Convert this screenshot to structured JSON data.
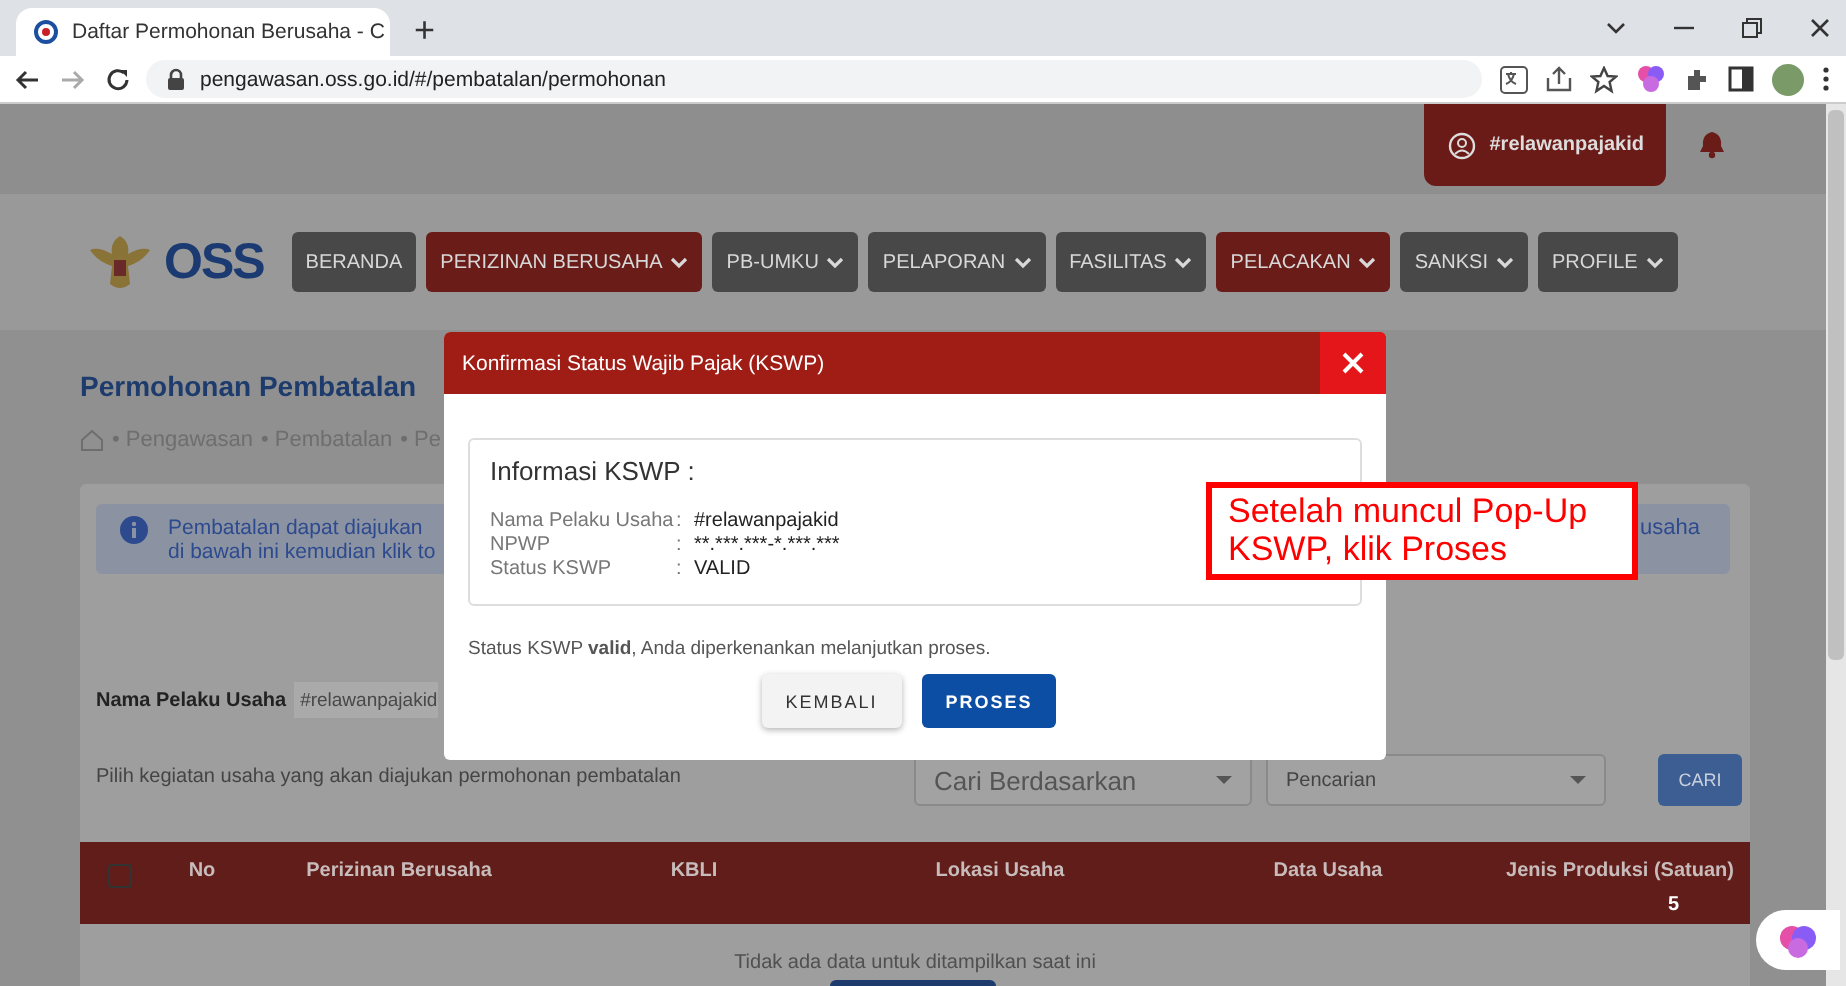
{
  "browser": {
    "tab_title": "Daftar Permohonan Berusaha - C",
    "new_tab": "+",
    "url": "pengawasan.oss.go.id/#/pembatalan/permohonan"
  },
  "header": {
    "user": "#relawanpajakid",
    "logo": "OSS",
    "nav": [
      {
        "label": "BERANDA",
        "has_menu": false,
        "highlighted": false
      },
      {
        "label": "PERIZINAN BERUSAHA",
        "has_menu": true,
        "highlighted": true
      },
      {
        "label": "PB-UMKU",
        "has_menu": true,
        "highlighted": false
      },
      {
        "label": "PELAPORAN",
        "has_menu": true,
        "highlighted": false
      },
      {
        "label": "FASILITAS",
        "has_menu": true,
        "highlighted": false
      },
      {
        "label": "PELACAKAN",
        "has_menu": true,
        "highlighted": true
      },
      {
        "label": "SANKSI",
        "has_menu": true,
        "highlighted": false
      },
      {
        "label": "PROFILE",
        "has_menu": true,
        "highlighted": false
      }
    ]
  },
  "page": {
    "title": "Permohonan Pembatalan",
    "breadcrumb": [
      "• Pengawasan",
      "• Pembatalan",
      "• Pe"
    ],
    "info": {
      "lines": [
        "Pembatalan dapat diajukan",
        "di bawah ini kemudian klik to"
      ],
      "tail": "usaha"
    },
    "owner": {
      "label": "Nama Pelaku Usaha",
      "value": "#relawanpajakid"
    },
    "instruction": "Pilih kegiatan usaha yang akan diajukan permohonan pembatalan",
    "search_by": {
      "placeholder": "Cari Berdasarkan"
    },
    "search": {
      "placeholder": "Pencarian"
    },
    "search_button": "CARI",
    "table": {
      "select_all": {
        "checked": false
      },
      "columns": [
        "No",
        "Perizinan Berusaha",
        "KBLI",
        "Lokasi Usaha",
        "Data Usaha",
        "Jenis Produksi (Satuan)"
      ],
      "empty": "Tidak ada data untuk ditampilkan saat ini"
    },
    "badge": "5"
  },
  "modal": {
    "title": "Konfirmasi Status Wajib Pajak (KSWP)",
    "section_title": "Informasi KSWP :",
    "fields": [
      {
        "label": "Nama Pelaku Usaha",
        "sep": ":",
        "value": "#relawanpajakid"
      },
      {
        "label": "NPWP",
        "sep": ":",
        "value": "**.***.***-*.***.***"
      },
      {
        "label": "Status KSWP",
        "sep": ":",
        "value": "VALID"
      }
    ],
    "note": "Status KSWP **valid**, Anda diperkenankan melanjutkan proses.",
    "buttons": [
      {
        "label": "KEMBALI",
        "kind": "secondary"
      },
      {
        "label": "PROSES",
        "kind": "primary"
      }
    ]
  },
  "annotation": {
    "text": "Setelah muncul Pop-Up KSWP, klik Proses"
  }
}
